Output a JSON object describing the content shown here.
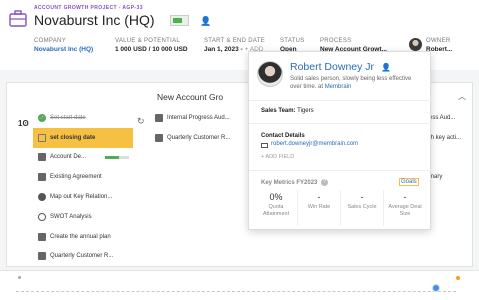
{
  "header": {
    "project_label": "ACCOUNT GROWTH PROJECT - AGP-33",
    "title": "Novaburst Inc (HQ)",
    "meta": [
      {
        "label": "COMPANY",
        "value": "Novaburst Inc (HQ)"
      },
      {
        "label": "VALUE & POTENTIAL",
        "value": "1 000 USD / 10 000 USD"
      },
      {
        "label": "START & END DATE",
        "value": "Jan 1, 2023 -",
        "add": "+ ADD"
      },
      {
        "label": "STATUS",
        "value": "Open"
      },
      {
        "label": "PROCESS",
        "value": "New Account Growt..."
      },
      {
        "label": "OWNER",
        "value": "Robert..."
      }
    ]
  },
  "board": {
    "title": "New Account Gro",
    "stages": [
      {
        "label": "Set start date",
        "icon": "check"
      },
      {
        "label": "set closing date",
        "icon": "square"
      },
      {
        "label": "Account De...",
        "icon": "document"
      },
      {
        "label": "Existing Agreement",
        "icon": "document"
      },
      {
        "label": "Map out Key Relation...",
        "icon": "person"
      },
      {
        "label": "SWOT Analysis",
        "icon": "target"
      },
      {
        "label": "Create the annual plan",
        "icon": "document"
      },
      {
        "label": "Quarterly Customer R...",
        "icon": "document"
      }
    ],
    "col2": [
      {
        "label": "Internal Progress Aud..."
      },
      {
        "label": "Quarterly Customer R..."
      }
    ],
    "col3": [
      {
        "label": "ess Aud..."
      },
      {
        "label": "th key acti..."
      },
      {
        "label": ""
      },
      {
        "label": "mary"
      }
    ]
  },
  "popup": {
    "name": "Robert Downey Jr",
    "bio": "Solid sales person, slowly being less effective over time. at",
    "bio_link": "Membrain",
    "team_label": "Sales Team:",
    "team_value": "Tigers",
    "contact_heading": "Contact Details",
    "email": "robert.downeyjr@membrain.com",
    "add_field": "+ ADD FIELD",
    "kpi_heading": "Key Metrics FY2023",
    "goals_link": "Goals",
    "kpis": [
      {
        "value": "0%",
        "label": "Quota Attainment"
      },
      {
        "value": "-",
        "label": "Win Rate"
      },
      {
        "value": "-",
        "label": "Sales Cycle"
      },
      {
        "value": "-",
        "label": "Average Deal Size"
      }
    ]
  }
}
